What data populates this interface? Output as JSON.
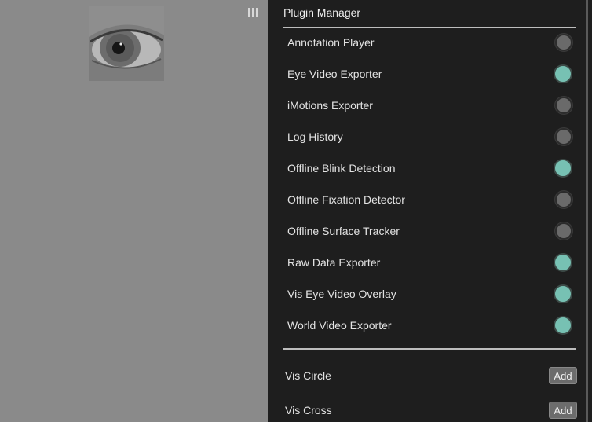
{
  "panel": {
    "title": "Plugin Manager",
    "plugins": [
      {
        "label": "Annotation Player",
        "enabled": false
      },
      {
        "label": "Eye Video Exporter",
        "enabled": true
      },
      {
        "label": "iMotions Exporter",
        "enabled": false
      },
      {
        "label": "Log History",
        "enabled": false
      },
      {
        "label": "Offline Blink Detection",
        "enabled": true
      },
      {
        "label": "Offline Fixation Detector",
        "enabled": false
      },
      {
        "label": "Offline Surface Tracker",
        "enabled": false
      },
      {
        "label": "Raw Data Exporter",
        "enabled": true
      },
      {
        "label": "Vis Eye Video Overlay",
        "enabled": true
      },
      {
        "label": "World Video Exporter",
        "enabled": true
      }
    ],
    "add_items": [
      {
        "label": "Vis Circle",
        "button": "Add"
      },
      {
        "label": "Vis Cross",
        "button": "Add"
      }
    ]
  },
  "colors": {
    "toggle_on": "#77c1b3",
    "toggle_off": "#6a6a6a",
    "panel_bg": "#1e1e1e",
    "canvas_bg": "#8a8a8a"
  },
  "icons": {
    "menu_handle": "menu-handle-icon",
    "eye_preview": "eye-video-thumbnail"
  }
}
